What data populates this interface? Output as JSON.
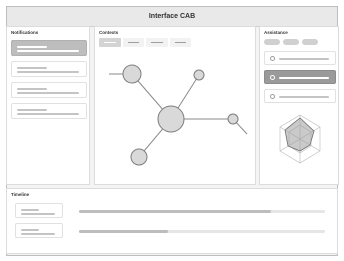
{
  "window": {
    "title": "Interface CAB"
  },
  "panels": {
    "notifications": {
      "title": "Notifications"
    },
    "contexts": {
      "title": "Contexts"
    },
    "assistance": {
      "title": "Assistance"
    },
    "timeline": {
      "title": "Timeline"
    }
  },
  "notifications": {
    "active_index": 0,
    "count": 4
  },
  "contexts": {
    "tabs": 4,
    "active_tab": 0
  },
  "assistance": {
    "pills": 3,
    "items": 3,
    "active_item": 1
  },
  "timeline": {
    "tracks": [
      {
        "progress": 0.78
      },
      {
        "progress": 0.36
      }
    ]
  },
  "colors": {
    "accent": "#bdbdbd",
    "node_fill": "#d9d9d9",
    "panel_bg": "#ffffff"
  }
}
